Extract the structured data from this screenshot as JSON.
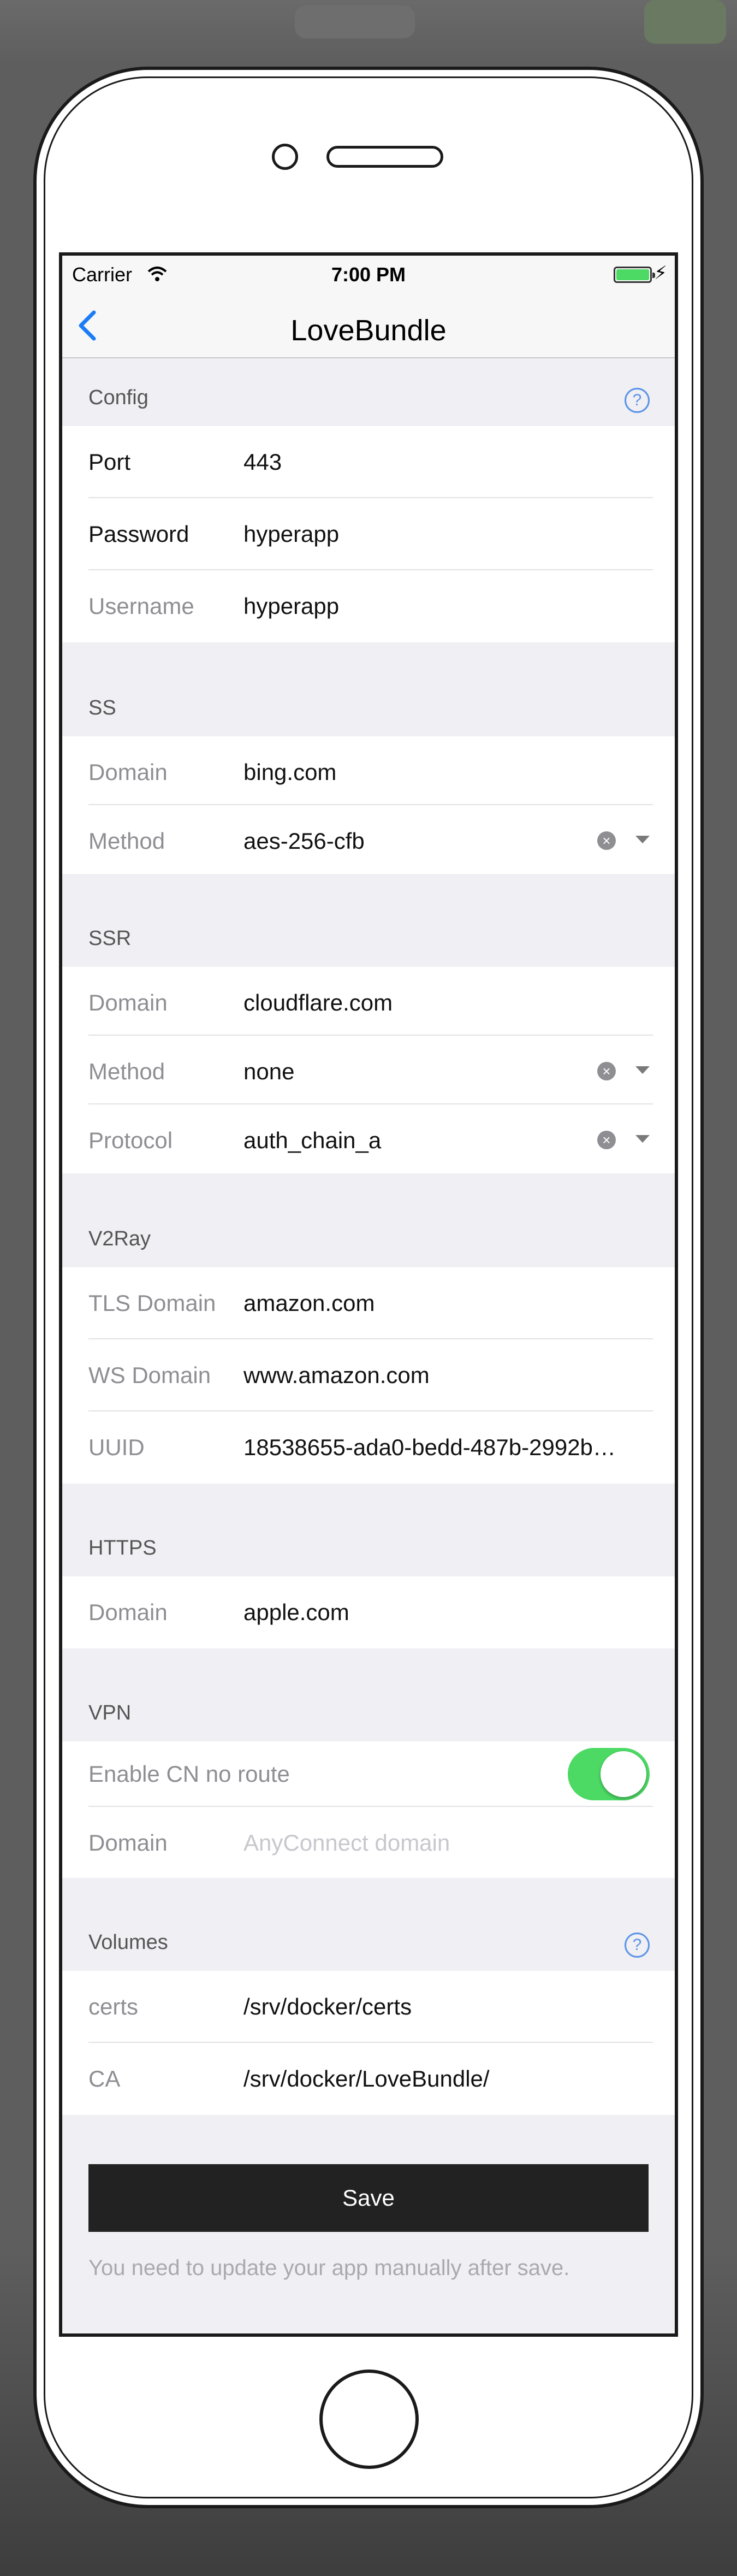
{
  "status_bar": {
    "carrier": "Carrier",
    "time": "7:00 PM",
    "battery_color": "#4cd964"
  },
  "nav": {
    "back_icon": "chevron-left-icon",
    "title": "LoveBundle",
    "accent": "#1b7cf5"
  },
  "sections": {
    "config": {
      "title": "Config",
      "help": "?",
      "port_label": "Port",
      "port_value": "443",
      "password_label": "Password",
      "password_value": "hyperapp",
      "username_label": "Username",
      "username_value": "hyperapp"
    },
    "ss": {
      "title": "SS",
      "domain_label": "Domain",
      "domain_value": "bing.com",
      "method_label": "Method",
      "method_value": "aes-256-cfb"
    },
    "ssr": {
      "title": "SSR",
      "domain_label": "Domain",
      "domain_value": "cloudflare.com",
      "method_label": "Method",
      "method_value": "none",
      "protocol_label": "Protocol",
      "protocol_value": "auth_chain_a"
    },
    "v2ray": {
      "title": "V2Ray",
      "tls_label": "TLS Domain",
      "tls_value": "amazon.com",
      "ws_label": "WS Domain",
      "ws_value": "www.amazon.com",
      "uuid_label": "UUID",
      "uuid_value": "18538655-ada0-bedd-487b-2992b…"
    },
    "https": {
      "title": "HTTPS",
      "domain_label": "Domain",
      "domain_value": "apple.com"
    },
    "vpn": {
      "title": "VPN",
      "cn_label": "Enable CN no route",
      "cn_enabled": true,
      "domain_label": "Domain",
      "domain_placeholder": "AnyConnect domain"
    },
    "volumes": {
      "title": "Volumes",
      "help": "?",
      "certs_label": "certs",
      "certs_value": "/srv/docker/certs",
      "ca_label": "CA",
      "ca_value": "/srv/docker/LoveBundle/"
    }
  },
  "footer": {
    "save_label": "Save",
    "note": "You need to update your app manually after save."
  }
}
